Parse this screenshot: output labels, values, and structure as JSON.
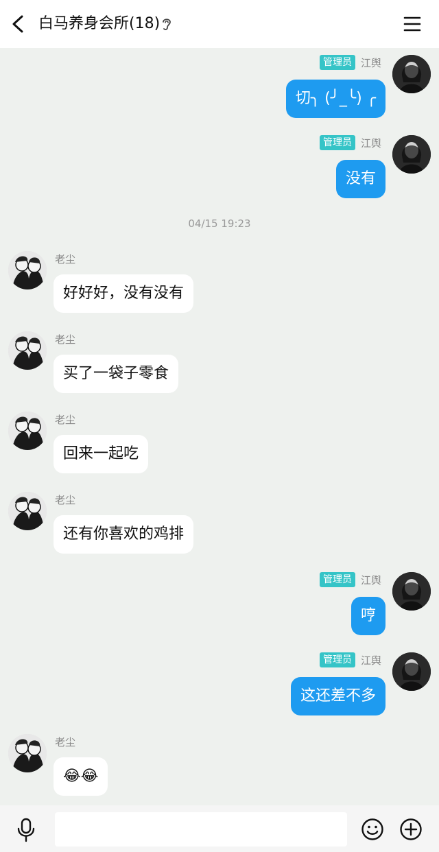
{
  "header": {
    "title": "白马养身会所(18)"
  },
  "messages": [
    {
      "side": "right",
      "badge": "管理员",
      "sender": "江舆",
      "text": "切╮ (╯_╰) ╭"
    },
    {
      "side": "right",
      "badge": "管理员",
      "sender": "江舆",
      "text": "没有"
    },
    {
      "timestamp": "04/15 19:23"
    },
    {
      "side": "left",
      "sender": "老尘",
      "text": "好好好，没有没有"
    },
    {
      "side": "left",
      "sender": "老尘",
      "text": "买了一袋子零食"
    },
    {
      "side": "left",
      "sender": "老尘",
      "text": "回来一起吃"
    },
    {
      "side": "left",
      "sender": "老尘",
      "text": "还有你喜欢的鸡排"
    },
    {
      "side": "right",
      "badge": "管理员",
      "sender": "江舆",
      "text": "哼"
    },
    {
      "side": "right",
      "badge": "管理员",
      "sender": "江舆",
      "text": "这还差不多"
    },
    {
      "side": "left",
      "sender": "老尘",
      "text": "😂😂"
    }
  ],
  "input": {
    "placeholder": ""
  },
  "colors": {
    "accent": "#1e9bf0",
    "badge": "#35c4c7",
    "background": "#eef1ee"
  },
  "icons": [
    "back-arrow-icon",
    "ear-icon",
    "menu-icon",
    "microphone-icon",
    "emoji-icon",
    "plus-icon"
  ]
}
